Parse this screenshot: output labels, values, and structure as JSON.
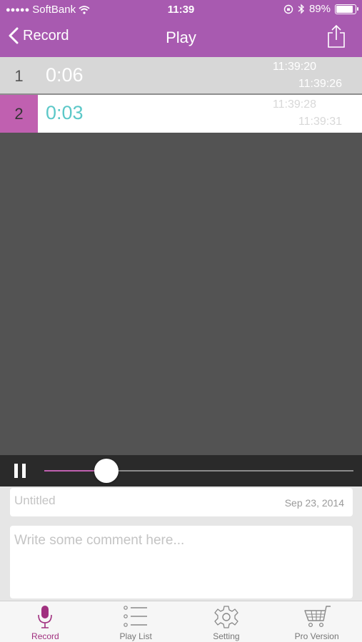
{
  "status_bar": {
    "signal": "●●●●●",
    "carrier": "SoftBank",
    "time": "11:39",
    "battery": "89%",
    "battery_level": 0.89
  },
  "nav": {
    "back_label": "Record",
    "title": "Play"
  },
  "recordings": [
    {
      "index": "1",
      "duration": "0:06",
      "start": "11:39:20",
      "end": "11:39:26"
    },
    {
      "index": "2",
      "duration": "0:03",
      "start": "11:39:28",
      "end": "11:39:31"
    }
  ],
  "player": {
    "progress": 0.2
  },
  "info": {
    "title_placeholder": "Untitled",
    "date": "Sep 23, 2014",
    "comment_placeholder": "Write some comment here..."
  },
  "tabs": [
    {
      "label": "Record",
      "icon": "microphone-icon"
    },
    {
      "label": "Play List",
      "icon": "list-icon"
    },
    {
      "label": "Setting",
      "icon": "gear-icon"
    },
    {
      "label": "Pro Version",
      "icon": "cart-icon"
    }
  ],
  "colors": {
    "accent": "#a85ab0",
    "highlight": "#c060b0",
    "duration_active": "#5cc8c8"
  }
}
